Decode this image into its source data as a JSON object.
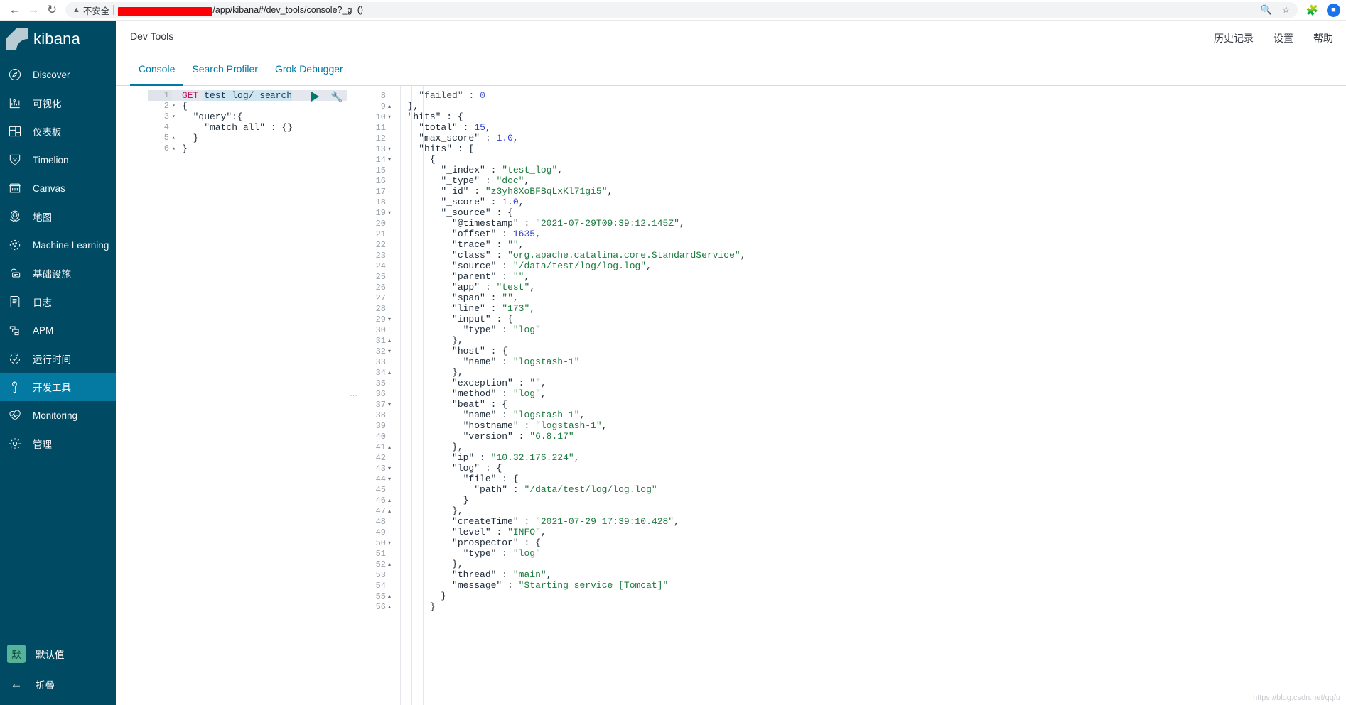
{
  "browser": {
    "back_icon": "arrow-left",
    "forward_icon": "arrow-right",
    "reload_icon": "reload",
    "warning_icon": "warning-triangle",
    "insecure_label": "不安全",
    "url_text": "/app/kibana#/dev_tools/console?_g=()",
    "zoom_icon": "zoom-search",
    "bookmark_icon": "star",
    "extensions_icon": "puzzle",
    "profile_initial": "●",
    "redacted_color": "#fb0007"
  },
  "sidebar": {
    "brand": "kibana",
    "items": [
      {
        "label": "Discover",
        "icon": "compass-icon",
        "active": false
      },
      {
        "label": "可视化",
        "icon": "chart-icon",
        "active": false
      },
      {
        "label": "仪表板",
        "icon": "dashboard-icon",
        "active": false
      },
      {
        "label": "Timelion",
        "icon": "timelion-icon",
        "active": false
      },
      {
        "label": "Canvas",
        "icon": "canvas-icon",
        "active": false
      },
      {
        "label": "地图",
        "icon": "map-pin-icon",
        "active": false
      },
      {
        "label": "Machine Learning",
        "icon": "ml-icon",
        "active": false
      },
      {
        "label": "基础设施",
        "icon": "infra-icon",
        "active": false
      },
      {
        "label": "日志",
        "icon": "logs-icon",
        "active": false
      },
      {
        "label": "APM",
        "icon": "apm-icon",
        "active": false
      },
      {
        "label": "运行时间",
        "icon": "uptime-icon",
        "active": false
      },
      {
        "label": "开发工具",
        "icon": "wrench-icon",
        "active": true
      },
      {
        "label": "Monitoring",
        "icon": "heartbeat-icon",
        "active": false
      },
      {
        "label": "管理",
        "icon": "gear-icon",
        "active": false
      }
    ],
    "space": {
      "badge": "默",
      "label": "默认值"
    },
    "collapse": {
      "label": "折叠",
      "icon": "arrow-left-icon"
    },
    "bg_color": "#014a63",
    "active_color": "#0479a1"
  },
  "header": {
    "title": "Dev Tools",
    "links": [
      "历史记录",
      "设置",
      "帮助"
    ]
  },
  "tabs": [
    {
      "label": "Console",
      "active": true
    },
    {
      "label": "Search Profiler",
      "active": false
    },
    {
      "label": "Grok Debugger",
      "active": false
    }
  ],
  "editor": {
    "play_label": "发送请求",
    "wrench_label": "工具菜单",
    "lines": [
      {
        "n": "1",
        "fold": "",
        "highlight": true,
        "tokens": [
          {
            "t": "GET ",
            "c": "tok-method"
          },
          {
            "t": "test_log/_se",
            "c": "tok-url"
          },
          {
            "t": "CARET",
            "c": "caret"
          },
          {
            "t": "arch",
            "c": "tok-url"
          }
        ]
      },
      {
        "n": "2",
        "fold": "▾",
        "highlight": false,
        "tokens": [
          {
            "t": "{",
            "c": "tok-punct"
          }
        ]
      },
      {
        "n": "3",
        "fold": "▾",
        "highlight": false,
        "tokens": [
          {
            "t": "  \"query\":{",
            "c": "tok-punct"
          }
        ]
      },
      {
        "n": "4",
        "fold": "",
        "highlight": false,
        "tokens": [
          {
            "t": "    \"match_all\" : {}",
            "c": "tok-punct"
          }
        ]
      },
      {
        "n": "5",
        "fold": "▴",
        "highlight": false,
        "tokens": [
          {
            "t": "  }",
            "c": "tok-punct"
          }
        ]
      },
      {
        "n": "6",
        "fold": "▴",
        "highlight": false,
        "tokens": [
          {
            "t": "}",
            "c": "tok-punct"
          }
        ]
      }
    ]
  },
  "output": {
    "lines": [
      {
        "n": "8",
        "fold": "",
        "indent": 4,
        "text": "\"failed\" : 0",
        "clipped": true
      },
      {
        "n": "9",
        "fold": "▴",
        "indent": 2,
        "text": "},"
      },
      {
        "n": "10",
        "fold": "▾",
        "indent": 2,
        "text": "\"hits\" : {"
      },
      {
        "n": "11",
        "fold": "",
        "indent": 4,
        "text": "\"total\" : 15,"
      },
      {
        "n": "12",
        "fold": "",
        "indent": 4,
        "text": "\"max_score\" : 1.0,"
      },
      {
        "n": "13",
        "fold": "▾",
        "indent": 4,
        "text": "\"hits\" : ["
      },
      {
        "n": "14",
        "fold": "▾",
        "indent": 6,
        "text": "{"
      },
      {
        "n": "15",
        "fold": "",
        "indent": 8,
        "text": "\"_index\" : \"test_log\","
      },
      {
        "n": "16",
        "fold": "",
        "indent": 8,
        "text": "\"_type\" : \"doc\","
      },
      {
        "n": "17",
        "fold": "",
        "indent": 8,
        "text": "\"_id\" : \"z3yh8XoBFBqLxKl71gi5\","
      },
      {
        "n": "18",
        "fold": "",
        "indent": 8,
        "text": "\"_score\" : 1.0,"
      },
      {
        "n": "19",
        "fold": "▾",
        "indent": 8,
        "text": "\"_source\" : {"
      },
      {
        "n": "20",
        "fold": "",
        "indent": 10,
        "text": "\"@timestamp\" : \"2021-07-29T09:39:12.145Z\","
      },
      {
        "n": "21",
        "fold": "",
        "indent": 10,
        "text": "\"offset\" : 1635,"
      },
      {
        "n": "22",
        "fold": "",
        "indent": 10,
        "text": "\"trace\" : \"\","
      },
      {
        "n": "23",
        "fold": "",
        "indent": 10,
        "text": "\"class\" : \"org.apache.catalina.core.StandardService\","
      },
      {
        "n": "24",
        "fold": "",
        "indent": 10,
        "text": "\"source\" : \"/data/test/log/log.log\","
      },
      {
        "n": "25",
        "fold": "",
        "indent": 10,
        "text": "\"parent\" : \"\","
      },
      {
        "n": "26",
        "fold": "",
        "indent": 10,
        "text": "\"app\" : \"test\","
      },
      {
        "n": "27",
        "fold": "",
        "indent": 10,
        "text": "\"span\" : \"\","
      },
      {
        "n": "28",
        "fold": "",
        "indent": 10,
        "text": "\"line\" : \"173\","
      },
      {
        "n": "29",
        "fold": "▾",
        "indent": 10,
        "text": "\"input\" : {"
      },
      {
        "n": "30",
        "fold": "",
        "indent": 12,
        "text": "\"type\" : \"log\""
      },
      {
        "n": "31",
        "fold": "▴",
        "indent": 10,
        "text": "},"
      },
      {
        "n": "32",
        "fold": "▾",
        "indent": 10,
        "text": "\"host\" : {"
      },
      {
        "n": "33",
        "fold": "",
        "indent": 12,
        "text": "\"name\" : \"logstash-1\""
      },
      {
        "n": "34",
        "fold": "▴",
        "indent": 10,
        "text": "},"
      },
      {
        "n": "35",
        "fold": "",
        "indent": 10,
        "text": "\"exception\" : \"\","
      },
      {
        "n": "36",
        "fold": "",
        "indent": 10,
        "text": "\"method\" : \"log\","
      },
      {
        "n": "37",
        "fold": "▾",
        "indent": 10,
        "text": "\"beat\" : {"
      },
      {
        "n": "38",
        "fold": "",
        "indent": 12,
        "text": "\"name\" : \"logstash-1\","
      },
      {
        "n": "39",
        "fold": "",
        "indent": 12,
        "text": "\"hostname\" : \"logstash-1\","
      },
      {
        "n": "40",
        "fold": "",
        "indent": 12,
        "text": "\"version\" : \"6.8.17\""
      },
      {
        "n": "41",
        "fold": "▴",
        "indent": 10,
        "text": "},"
      },
      {
        "n": "42",
        "fold": "",
        "indent": 10,
        "text": "\"ip\" : \"10.32.176.224\","
      },
      {
        "n": "43",
        "fold": "▾",
        "indent": 10,
        "text": "\"log\" : {"
      },
      {
        "n": "44",
        "fold": "▾",
        "indent": 12,
        "text": "\"file\" : {"
      },
      {
        "n": "45",
        "fold": "",
        "indent": 14,
        "text": "\"path\" : \"/data/test/log/log.log\""
      },
      {
        "n": "46",
        "fold": "▴",
        "indent": 12,
        "text": "}"
      },
      {
        "n": "47",
        "fold": "▴",
        "indent": 10,
        "text": "},"
      },
      {
        "n": "48",
        "fold": "",
        "indent": 10,
        "text": "\"createTime\" : \"2021-07-29 17:39:10.428\","
      },
      {
        "n": "49",
        "fold": "",
        "indent": 10,
        "text": "\"level\" : \"INFO\","
      },
      {
        "n": "50",
        "fold": "▾",
        "indent": 10,
        "text": "\"prospector\" : {"
      },
      {
        "n": "51",
        "fold": "",
        "indent": 12,
        "text": "\"type\" : \"log\""
      },
      {
        "n": "52",
        "fold": "▴",
        "indent": 10,
        "text": "},"
      },
      {
        "n": "53",
        "fold": "",
        "indent": 10,
        "text": "\"thread\" : \"main\","
      },
      {
        "n": "54",
        "fold": "",
        "indent": 10,
        "text": "\"message\" : \"Starting service [Tomcat]\""
      },
      {
        "n": "55",
        "fold": "▴",
        "indent": 8,
        "text": "}"
      },
      {
        "n": "56",
        "fold": "▴",
        "indent": 6,
        "text": "}"
      }
    ]
  },
  "watermark": "https://blog.csdn.net/qq/u"
}
